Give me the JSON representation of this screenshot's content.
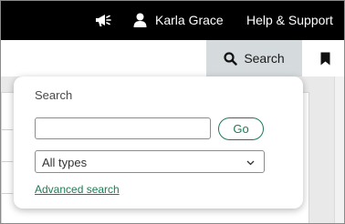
{
  "topbar": {
    "announce_icon": "megaphone-icon",
    "user_icon": "person-icon",
    "user_name": "Karla Grace",
    "help_label": "Help & Support"
  },
  "toolbar": {
    "search_icon": "magnifier-icon",
    "search_label": "Search",
    "bookmark_icon": "bookmark-icon"
  },
  "search_panel": {
    "title": "Search",
    "query_value": "",
    "go_label": "Go",
    "type_selected": "All types",
    "advanced_link": "Advanced search"
  },
  "colors": {
    "topbar_bg": "#000000",
    "search_tab_bg": "#d5dadd",
    "accent_green": "#1f7a55"
  }
}
